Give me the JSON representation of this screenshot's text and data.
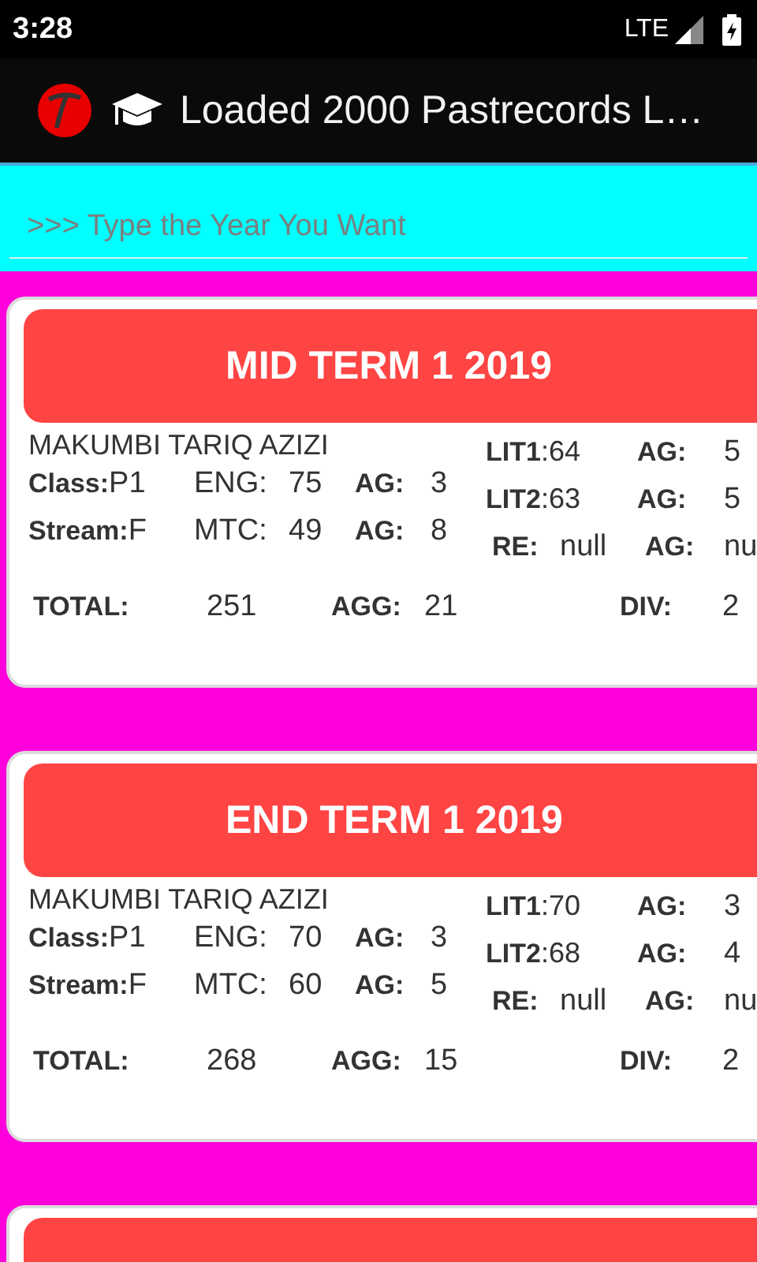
{
  "status_bar": {
    "time": "3:28",
    "network": "LTE"
  },
  "app_bar": {
    "title": "Loaded 2000 Pastrecords L…"
  },
  "search": {
    "placeholder": ">>> Type the Year You Want"
  },
  "cards": [
    {
      "kind": "full",
      "title": "MID TERM 1 2019",
      "name": "MAKUMBI TARIQ AZIZI",
      "info": [
        {
          "label": "Class:",
          "value": "P1"
        },
        {
          "label": "Stream:",
          "value": "F"
        }
      ],
      "left_subjects": [
        {
          "subject": "ENG:",
          "score": "75",
          "ag_label": "AG:",
          "ag": "3"
        },
        {
          "subject": "MTC:",
          "score": "49",
          "ag_label": "AG:",
          "ag": "8"
        }
      ],
      "right_subjects": [
        {
          "kind": "joined",
          "subject": "LIT1",
          "score": ":64",
          "ag_label": "AG:",
          "ag": "5"
        },
        {
          "kind": "joined",
          "subject": "LIT2",
          "score": ":63",
          "ag_label": "AG:",
          "ag": "5"
        },
        {
          "kind": "spaced",
          "subject": "RE:",
          "score": "null",
          "ag_label": "AG:",
          "ag": "nu"
        }
      ],
      "totals": {
        "total_label": "TOTAL:",
        "total": "251",
        "agg_label": "AGG:",
        "agg": "21",
        "div_label": "DIV:",
        "div": "2"
      }
    },
    {
      "kind": "full",
      "title": "END TERM 1 2019",
      "name": "MAKUMBI TARIQ AZIZI",
      "info": [
        {
          "label": "Class:",
          "value": "P1"
        },
        {
          "label": "Stream:",
          "value": "F"
        }
      ],
      "left_subjects": [
        {
          "subject": "ENG:",
          "score": "70",
          "ag_label": "AG:",
          "ag": "3"
        },
        {
          "subject": "MTC:",
          "score": "60",
          "ag_label": "AG:",
          "ag": "5"
        }
      ],
      "right_subjects": [
        {
          "kind": "joined",
          "subject": "LIT1",
          "score": ":70",
          "ag_label": "AG:",
          "ag": "3"
        },
        {
          "kind": "joined",
          "subject": "LIT2",
          "score": ":68",
          "ag_label": "AG:",
          "ag": "4"
        },
        {
          "kind": "spaced",
          "subject": "RE:",
          "score": "null",
          "ag_label": "AG:",
          "ag": "nu"
        }
      ],
      "totals": {
        "total_label": "TOTAL:",
        "total": "268",
        "agg_label": "AGG:",
        "agg": "15",
        "div_label": "DIV:",
        "div": "2"
      }
    },
    {
      "kind": "partial"
    }
  ]
}
